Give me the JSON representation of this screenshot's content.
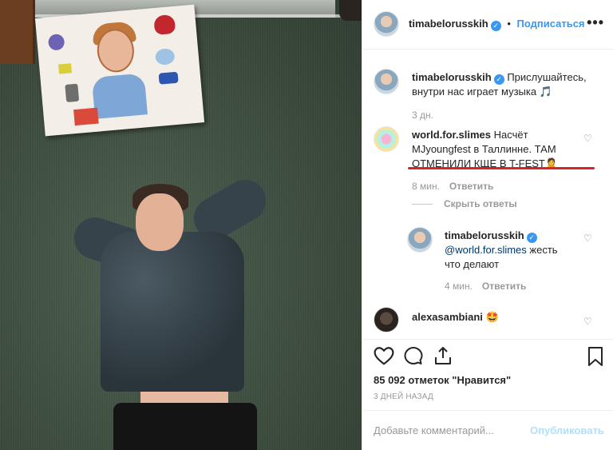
{
  "post": {
    "username": "timabelorusskih",
    "follow_label": "Подписаться",
    "more_label": "•••"
  },
  "caption": {
    "username": "timabelorusskih",
    "text_line1": "Прислушайтесь,",
    "text_line2": "внутри нас играет музыка 🎵",
    "time": "3 дн."
  },
  "comments": [
    {
      "username": "world.for.slimes",
      "text_line1": "Насчёт",
      "text_line2": "MJyoungfest в Таллинне. ТАМ",
      "text_line3": "ОТМЕНИЛИ КЩЕ В T-FEST",
      "emoji": "🙎",
      "time": "8 мин.",
      "reply_label": "Ответить",
      "hide_replies_label": "Скрыть ответы"
    },
    {
      "username": "timabelorusskih",
      "mention": "@world.for.slimes",
      "text_line1": "жесть",
      "text_line2": "что делают",
      "time": "4 мин.",
      "reply_label": "Ответить"
    },
    {
      "username": "alexasambiani",
      "emoji": "🤩"
    }
  ],
  "likes_text": "85 092 отметок \"Нравится\"",
  "posted_ago": "3 ДНЕЙ НАЗАД",
  "add_comment_placeholder": "Добавьте комментарий...",
  "publish_label": "Опубликовать",
  "verified_mark": "✓",
  "heart_glyph": "♡",
  "colors": {
    "link": "#3897f0",
    "underline": "#d9232a",
    "muted": "#999999"
  }
}
